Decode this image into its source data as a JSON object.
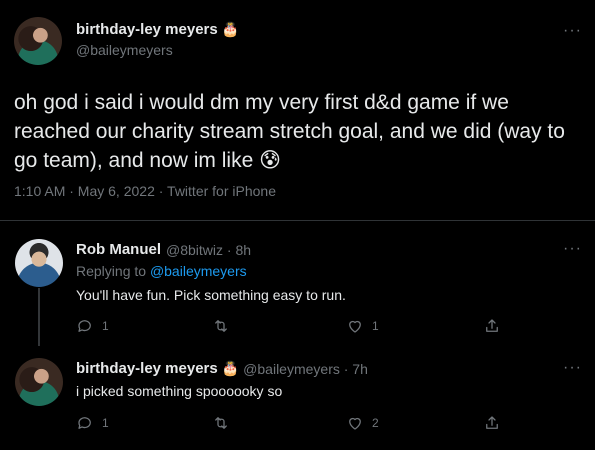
{
  "main_tweet": {
    "display_name": "birthday-ley meyers",
    "emoji": "🎂",
    "handle": "@baileymeyers",
    "more_label": "···",
    "text": "oh god i said i would dm my very first d&d game if we reached our charity stream stretch goal, and we did (way to go team), and now im like",
    "text_emoji": "😰",
    "timestamp": "1:10 AM · May 6, 2022 · Twitter for iPhone"
  },
  "replies": [
    {
      "display_name": "Rob Manuel",
      "handle_time": "@8bitwiz · 8h",
      "replying_prefix": "Replying to",
      "replying_to": "@baileymeyers",
      "text": "You'll have fun. Pick something easy to run.",
      "reply_count": "1",
      "like_count": "1",
      "more_label": "···"
    },
    {
      "display_name": "birthday-ley meyers",
      "emoji": "🎂",
      "handle_time": "@baileymeyers · 7h",
      "text": "i picked something spoooooky so",
      "reply_count": "1",
      "like_count": "2",
      "more_label": "···"
    }
  ],
  "icons": [
    "reply-icon",
    "retweet-icon",
    "like-icon",
    "share-icon",
    "more-icon"
  ]
}
